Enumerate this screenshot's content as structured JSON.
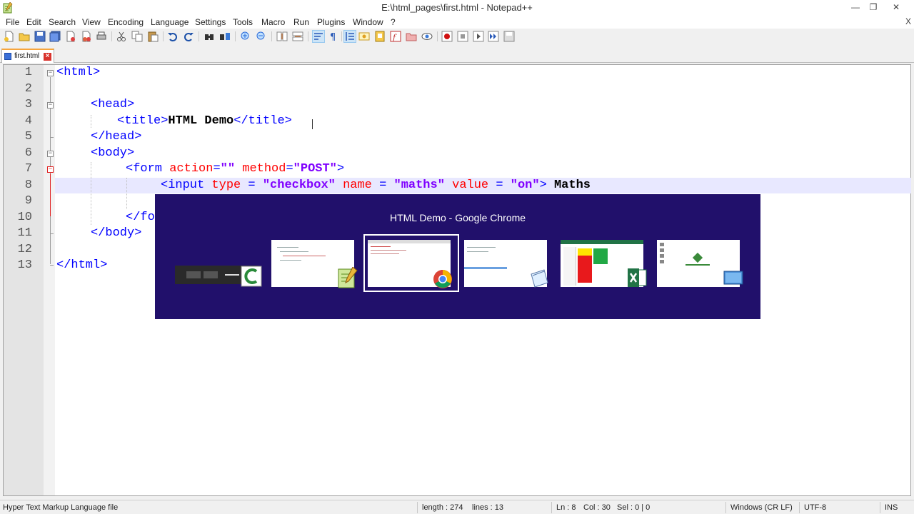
{
  "window": {
    "title": "E:\\html_pages\\first.html - Notepad++",
    "minimize": "—",
    "restore": "❐",
    "close": "✕"
  },
  "menu": [
    "File",
    "Edit",
    "Search",
    "View",
    "Encoding",
    "Language",
    "Settings",
    "Tools",
    "Macro",
    "Run",
    "Plugins",
    "Window",
    "?"
  ],
  "menu_close": "X",
  "toolbar_icons": [
    "new-file-icon",
    "open-file-icon",
    "save-icon",
    "save-all-icon",
    "close-icon",
    "close-all-icon",
    "print-icon",
    "cut-icon",
    "copy-icon",
    "paste-icon",
    "undo-icon",
    "redo-icon",
    "find-icon",
    "replace-icon",
    "zoom-in-icon",
    "zoom-out-icon",
    "sync-vertical-icon",
    "sync-horizontal-icon",
    "word-wrap-icon",
    "show-all-characters-icon",
    "indent-guide-icon",
    "user-defined-language-icon",
    "doc-map-icon",
    "function-list-icon",
    "folder-workspace-icon",
    "monitoring-icon",
    "record-macro-icon",
    "stop-macro-icon",
    "play-macro-icon",
    "run-macro-multiple-icon",
    "save-macro-icon"
  ],
  "tab": {
    "label": "first.html",
    "close": "×"
  },
  "editor": {
    "line_numbers": [
      "1",
      "2",
      "3",
      "4",
      "5",
      "6",
      "7",
      "8",
      "9",
      "10",
      "11",
      "12",
      "13"
    ],
    "lines": {
      "l1": [
        "<html>"
      ],
      "l3": [
        "<head>"
      ],
      "l4": [
        "<title>",
        "HTML Demo",
        "</title>"
      ],
      "l5": [
        "</head>"
      ],
      "l6": [
        "<body>"
      ],
      "l7": [
        "<form ",
        "action",
        "=",
        "\"\"",
        " ",
        "method",
        "=",
        "\"POST\"",
        ">"
      ],
      "l8": [
        "<input ",
        "type",
        " = ",
        "\"checkbox\"",
        " ",
        "name",
        " = ",
        "\"maths\"",
        " ",
        "value",
        " = ",
        "\"on\"",
        ">",
        " Maths"
      ],
      "l10": [
        "</fo"
      ],
      "l11": [
        "</body>"
      ],
      "l13": [
        "</html>"
      ]
    }
  },
  "switcher": {
    "title": "HTML Demo - Google Chrome",
    "items": [
      "camtasia-recorder",
      "notepad-plus-plus",
      "google-chrome",
      "notepad",
      "microsoft-excel",
      "desktop"
    ],
    "selected_index": 2
  },
  "status": {
    "language": "Hyper Text Markup Language file",
    "length": "length : 274",
    "lines": "lines : 13",
    "ln": "Ln : 8",
    "col": "Col : 30",
    "sel": "Sel : 0 | 0",
    "eol": "Windows (CR LF)",
    "encoding": "UTF-8",
    "mode": "INS"
  },
  "colors": {
    "tag": "#0000ff",
    "attribute": "#ff0000",
    "value": "#8000ff",
    "switcher_bg": "#21106b",
    "current_line": "#e8e8ff"
  }
}
